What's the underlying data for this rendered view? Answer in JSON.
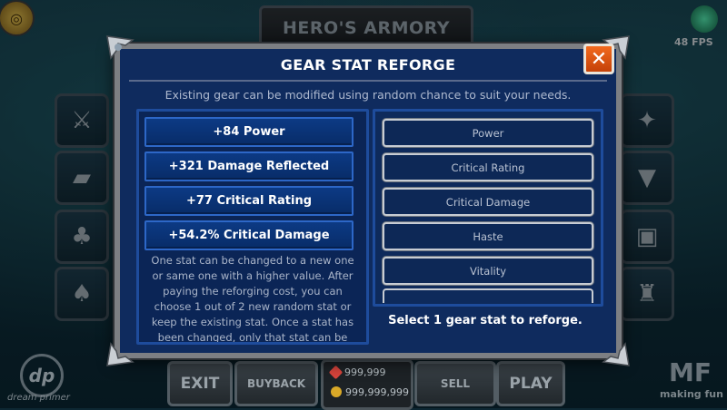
{
  "header": {
    "title": "HERO'S ARMORY",
    "fps": "48 FPS",
    "coin_glyph": "◎"
  },
  "side_slots_left": [
    "weapon-icon",
    "book-icon",
    "cloak-icon",
    "boots-icon"
  ],
  "side_slots_right": [
    "rune-icon",
    "anvil-icon",
    "chest-icon",
    "helmet-icon"
  ],
  "bottom_bar": {
    "exit_label": "EXIT",
    "buyback_label": "BUYBACK",
    "gems": "999,999",
    "gold": "999,999,999",
    "sell_label": "SELL",
    "play_label": "PLAY"
  },
  "logos": {
    "left_mark": "dp",
    "left_text": "dream primer",
    "right_mark": "MF",
    "right_text": "making fun"
  },
  "modal": {
    "title": "GEAR STAT REFORGE",
    "close_glyph": "✕",
    "subtitle": "Existing gear can be modified using random chance to suit your needs.",
    "current_stats": [
      "+84 Power",
      "+321 Damage Reflected",
      "+77 Critical Rating",
      "+54.2% Critical Damage"
    ],
    "description": "One stat can be changed to a new one or same one with a higher value. After paying the reforging cost, you can choose 1 out of 2 new random stat or keep the existing stat. Once a stat has been changed, only that stat can be",
    "reforge_options": [
      "Power",
      "Critical Rating",
      "Critical Damage",
      "Haste",
      "Vitality"
    ],
    "hint": "Select 1 gear stat to reforge."
  },
  "colors": {
    "modal_bg": "#0f2b5e",
    "panel_border": "#1e4c9c",
    "close_button": "#e8561a",
    "frame": "#7d7f83"
  }
}
